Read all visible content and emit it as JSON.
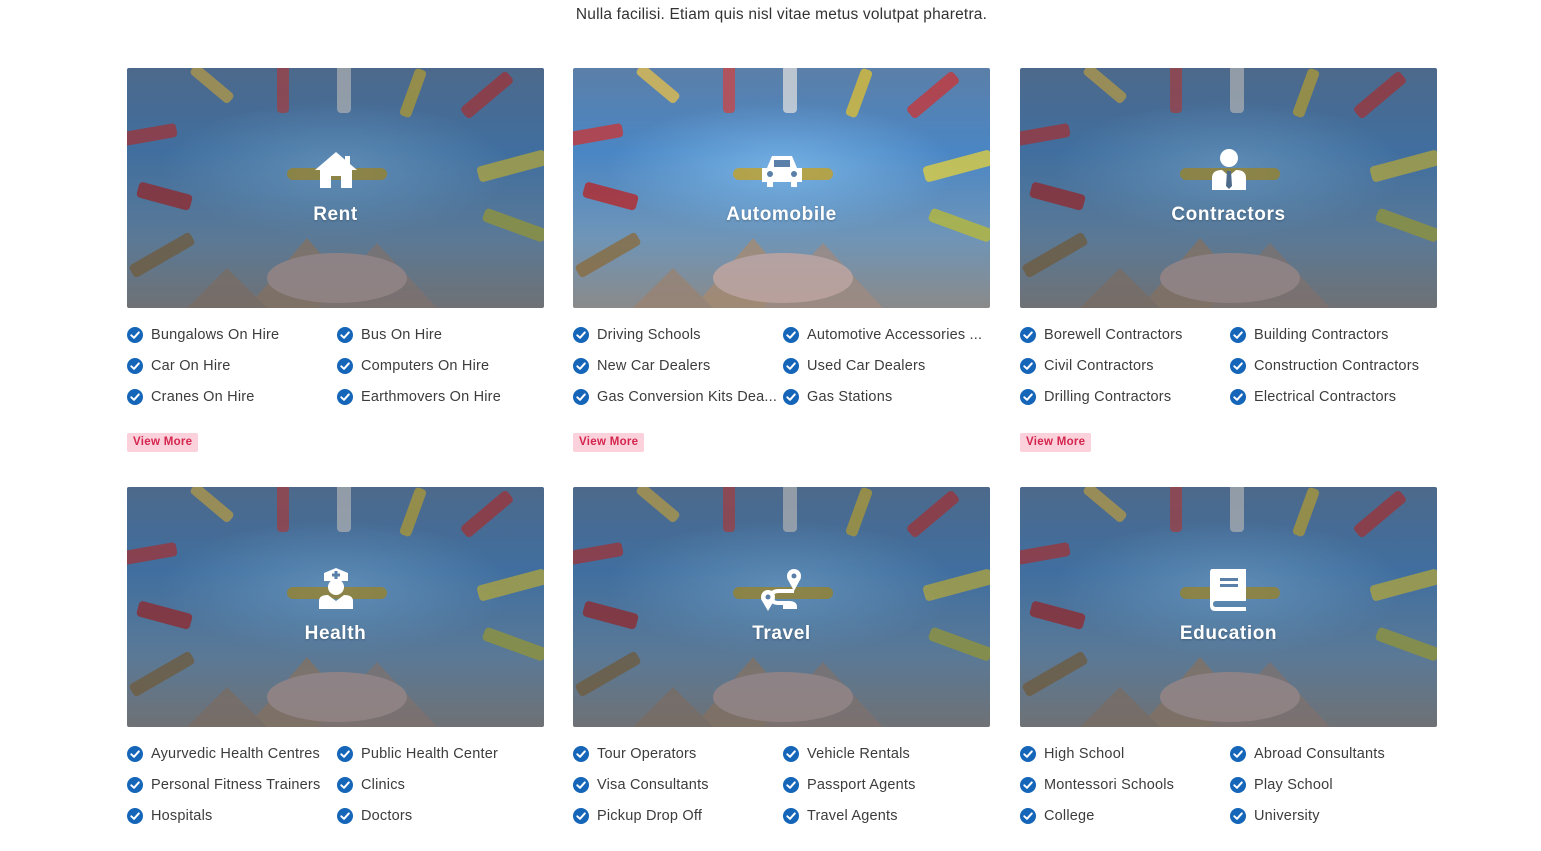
{
  "subtitle": "Nulla facilisi. Etiam quis nisl vitae metus volutpat pharetra.",
  "view_more_label": "View More",
  "categories": [
    {
      "title": "Rent",
      "icon": "house-icon",
      "items": [
        "Bungalows On Hire",
        "Bus On Hire",
        "Car On Hire",
        "Computers On Hire",
        "Cranes On Hire",
        "Earthmovers On Hire"
      ]
    },
    {
      "title": "Automobile",
      "icon": "car-icon",
      "items": [
        "Driving Schools",
        "Automotive Accessories ...",
        "New Car Dealers",
        "Used Car Dealers",
        "Gas Conversion Kits Dea...",
        "Gas Stations"
      ]
    },
    {
      "title": "Contractors",
      "icon": "person-tie-icon",
      "items": [
        "Borewell Contractors",
        "Building Contractors",
        "Civil Contractors",
        "Construction Contractors",
        "Drilling Contractors",
        "Electrical Contractors"
      ]
    },
    {
      "title": "Health",
      "icon": "nurse-icon",
      "items": [
        "Ayurvedic Health Centres",
        "Public Health Center",
        "Personal Fitness Trainers",
        "Clinics",
        "Hospitals",
        "Doctors"
      ]
    },
    {
      "title": "Travel",
      "icon": "route-icon",
      "items": [
        "Tour Operators",
        "Vehicle Rentals",
        "Visa Consultants",
        "Passport Agents",
        "Pickup Drop Off",
        "Travel Agents"
      ]
    },
    {
      "title": "Education",
      "icon": "book-icon",
      "items": [
        "High School",
        "Abroad Consultants",
        "Montessori Schools",
        "Play School",
        "College",
        "University"
      ]
    }
  ],
  "colors": {
    "check": "#1565b8",
    "view_more_bg": "#fbd2dc",
    "view_more_text": "#d4254d"
  }
}
